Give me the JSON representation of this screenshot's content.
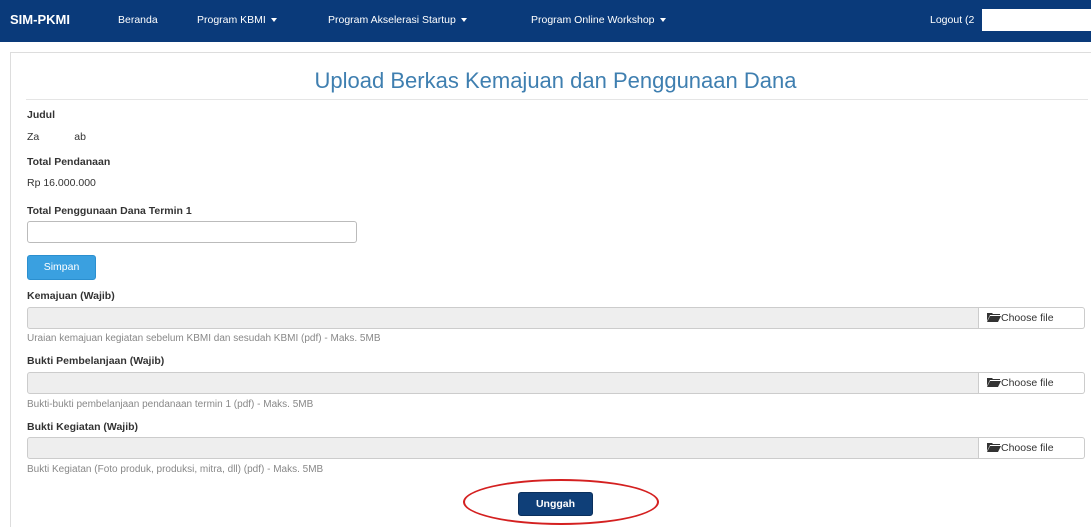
{
  "navbar": {
    "brand": "SIM-PKMI",
    "items": [
      {
        "label": "Beranda",
        "dropdown": false
      },
      {
        "label": "Program KBMI",
        "dropdown": true
      },
      {
        "label": "Program Akselerasi Startup",
        "dropdown": true
      },
      {
        "label": "Program Online Workshop",
        "dropdown": true
      }
    ],
    "logout_label": "Logout (2",
    "bg_color": "#0a3a7a"
  },
  "page": {
    "title": "Upload Berkas Kemajuan dan Penggunaan Dana"
  },
  "info": {
    "judul_label": "Judul",
    "judul_value": "Za            ab",
    "total_pendanaan_label": "Total Pendanaan",
    "total_pendanaan_value": "Rp 16.000.000",
    "penggunaan_label": "Total Penggunaan Dana Termin 1",
    "penggunaan_value": "",
    "save_label": "Simpan"
  },
  "uploads": [
    {
      "label": "Kemajuan (Wajib)",
      "button": "Choose file",
      "help": "Uraian kemajuan kegiatan sebelum KBMI dan sesudah KBMI (pdf) - Maks. 5MB"
    },
    {
      "label": "Bukti Pembelanjaan (Wajib)",
      "button": "Choose file",
      "help": "Bukti-bukti pembelanjaan pendanaan termin 1 (pdf) - Maks. 5MB"
    },
    {
      "label": "Bukti Kegiatan (Wajib)",
      "button": "Choose file",
      "help": "Bukti Kegiatan (Foto produk, produksi, mitra, dll) (pdf) - Maks. 5MB"
    }
  ],
  "submit_label": "Unggah",
  "colors": {
    "title": "#3f7fb0",
    "save_button": "#3aa0e0",
    "upload_button": "#0f3f78",
    "highlight": "#d42020"
  }
}
